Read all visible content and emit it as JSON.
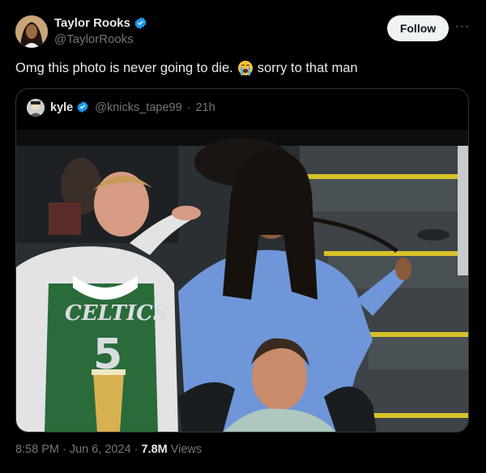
{
  "post": {
    "author": {
      "display_name": "Taylor Rooks",
      "handle": "@TaylorRooks",
      "verified_icon": "verified-badge-icon"
    },
    "follow_label": "Follow",
    "more_label": "···",
    "text_before_emoji": "Omg this photo is never going to die.",
    "emoji": "loudly-crying-face-icon",
    "text_after_emoji": "sorry to that man",
    "timestamp": {
      "time": "8:58 PM",
      "sep1": "·",
      "date": "Jun 6, 2024",
      "sep2": "·",
      "views": "7.8M",
      "views_label": "Views"
    }
  },
  "quote": {
    "display_name": "kyle",
    "handle": "@knicks_tape99",
    "sep": "·",
    "age": "21h",
    "photo_jersey_text": "CELTICS",
    "photo_jersey_number": "5"
  },
  "colors": {
    "background": "#000000",
    "text_primary": "#e7e9ea",
    "text_secondary": "#71767b",
    "verified_blue": "#1d9bf0",
    "follow_bg": "#eff3f4"
  }
}
